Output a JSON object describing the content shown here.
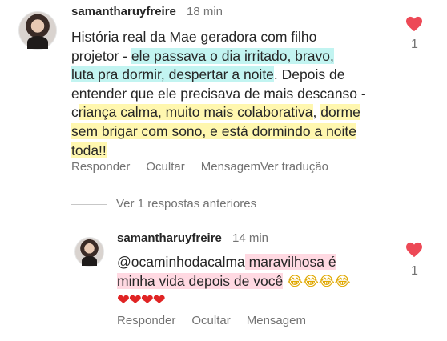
{
  "comment1": {
    "username": "samantharuyfreire",
    "time": "18 min",
    "lines": [
      [
        "História real da Mae geradora com filho",
        "",
        ""
      ],
      [
        "projetor - ",
        "ele passava o dia irritado, bravo,",
        ""
      ],
      [
        "luta pra dormir, despertar a noite",
        ". Depois de",
        ""
      ],
      [
        "entender que ele precisava de mais descanso -",
        "",
        ""
      ],
      [
        "c",
        "riança calma, muito mais colaborativa",
        ", "
      ],
      [
        "dorme",
        "",
        ""
      ],
      [
        "sem brigar com sono, e está dormindo a noite",
        "",
        ""
      ],
      [
        "toda!!",
        "",
        ""
      ]
    ],
    "text": {
      "l1": "História real da Mae geradora com filho",
      "l2a": "projetor - ",
      "l2b": "ele passava o dia irritado, bravo,",
      "l3a": "luta pra dormir, despertar a noite",
      "l3b": ". Depois de",
      "l4": "entender que ele precisava de mais descanso -",
      "l5a": "c",
      "l5b": "riança calma, muito mais colaborativa",
      "l5c": ", ",
      "l5d": "dorme",
      "l6": "sem brigar com sono, e está dormindo a noite",
      "l7": "toda!!"
    },
    "actions": {
      "reply": "Responder",
      "hide": "Ocultar",
      "message": "Mensagem",
      "translate": "Ver tradução"
    },
    "like_count": "1"
  },
  "view_previous": "Ver 1 respostas anteriores",
  "reply1": {
    "username": "samantharuyfreire",
    "time": "14 min",
    "text": {
      "mention": "@ocaminhodacalma",
      "l1b": " maravilhosa é",
      "l2": "minha vida depois de você",
      "emoji_laugh": "😂😂😂😂",
      "emoji_hearts": "❤❤❤❤"
    },
    "actions": {
      "reply": "Responder",
      "hide": "Ocultar",
      "message": "Mensagem"
    },
    "like_count": "1"
  },
  "colors": {
    "highlight_teal": "#78e6e1",
    "highlight_yellow": "#fff06e",
    "highlight_pink": "#ffaabe",
    "heart_red": "#ed4956",
    "muted_text": "#737373"
  }
}
